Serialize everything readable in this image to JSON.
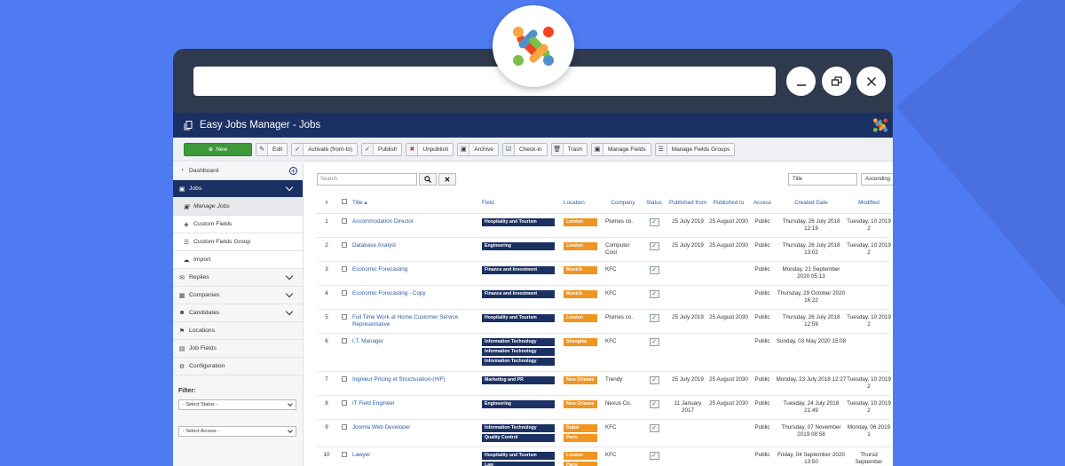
{
  "app": {
    "title": "Easy Jobs Manager - Jobs"
  },
  "toolbar": {
    "new_label": "New",
    "edit_label": "Edit",
    "activate_label": "Activate (from-to)",
    "publish_label": "Publish",
    "unpublish_label": "Unpublish",
    "archive_label": "Archive",
    "checkin_label": "Check-in",
    "trash_label": "Trash",
    "manage_fields_label": "Manage Fields",
    "manage_fields_groups_label": "Manage Fields Groups"
  },
  "sidebar": {
    "items": [
      {
        "label": "Dashboard",
        "icon": "dashboard-icon"
      },
      {
        "label": "Jobs",
        "icon": "briefcase-icon"
      },
      {
        "label": "Manage Jobs",
        "icon": "briefcase-icon"
      },
      {
        "label": "Custom Fields",
        "icon": "cube-icon"
      },
      {
        "label": "Custom Fields Group",
        "icon": "list-icon"
      },
      {
        "label": "Import",
        "icon": "cloud-upload-icon"
      },
      {
        "label": "Replies",
        "icon": "envelope-icon"
      },
      {
        "label": "Companies",
        "icon": "building-icon"
      },
      {
        "label": "Candidates",
        "icon": "users-icon"
      },
      {
        "label": "Locations",
        "icon": "map-icon"
      },
      {
        "label": "Job Fields",
        "icon": "folder-icon"
      },
      {
        "label": "Configuration",
        "icon": "gear-icon"
      }
    ],
    "filter_label": "Filter:",
    "status_select": "- Select Status -",
    "access_select": "- Select Access -"
  },
  "search": {
    "placeholder": "Search",
    "sort_field": "Title",
    "sort_dir": "Ascending"
  },
  "table": {
    "headers": {
      "num": "#",
      "title": "Title ▴",
      "field": "Field",
      "location": "Location",
      "company": "Company",
      "status": "Status",
      "published_from": "Published from",
      "published_to": "Published to",
      "access": "Access",
      "created": "Created Date",
      "modified": "Modified"
    },
    "rows": [
      {
        "num": "1",
        "title": "Accommodation Director",
        "fields": [
          "Hospitality and Tourism"
        ],
        "locations": [
          "London"
        ],
        "company": "Plumes co.",
        "from": "25 July 2019",
        "to": "25 August 2030",
        "access": "Public",
        "created": "Thursday, 26 July 2018 12:19",
        "modified": "Tuesday, 10 2019 2"
      },
      {
        "num": "2",
        "title": "Database Analyst",
        "fields": [
          "Engineering"
        ],
        "locations": [
          "London"
        ],
        "company": "Computer Cool",
        "from": "25 July 2019",
        "to": "25 August 2030",
        "access": "Public",
        "created": "Thursday, 26 July 2018 13:02",
        "modified": "Tuesday, 10 2019 2"
      },
      {
        "num": "3",
        "title": "Economic Forecasting",
        "fields": [
          "Finance and Investment"
        ],
        "locations": [
          "Munich"
        ],
        "company": "KFC",
        "from": "",
        "to": "",
        "access": "Public",
        "created": "Monday, 21 September 2020 05:13",
        "modified": ""
      },
      {
        "num": "4",
        "title": "Economic Forecasting - Copy",
        "fields": [
          "Finance and Investment"
        ],
        "locations": [
          "Munich"
        ],
        "company": "KFC",
        "from": "",
        "to": "",
        "access": "Public",
        "created": "Thursday, 29 October 2020 16:22",
        "modified": ""
      },
      {
        "num": "5",
        "title": "Full Time Work at Home Customer Service Representative",
        "fields": [
          "Hospitality and Tourism"
        ],
        "locations": [
          "London"
        ],
        "company": "Plumes co.",
        "from": "25 July 2019",
        "to": "25 August 2030",
        "access": "Public",
        "created": "Thursday, 26 July 2018 12:59",
        "modified": "Tuesday, 10 2019 2"
      },
      {
        "num": "6",
        "title": "I.T. Manager",
        "fields": [
          "Information Technology",
          "Information Technology",
          "Information Technology"
        ],
        "locations": [
          "Shanghai"
        ],
        "company": "KFC",
        "from": "",
        "to": "",
        "access": "Public",
        "created": "Sunday, 03 May 2020 15:08",
        "modified": ""
      },
      {
        "num": "7",
        "title": "Ingnieur Pricing et Structuration-(H/F)",
        "fields": [
          "Marketing and PR"
        ],
        "locations": [
          "New Orleans"
        ],
        "company": "Trendy",
        "from": "25 July 2019",
        "to": "25 August 2030",
        "access": "Public",
        "created": "Monday, 23 July 2018 12:27",
        "modified": "Tuesday, 10 2019 2"
      },
      {
        "num": "8",
        "title": "IT Field Engineer",
        "fields": [
          "Engineering"
        ],
        "locations": [
          "New Orleans"
        ],
        "company": "Nexus Co.",
        "from": "11 January 2017",
        "to": "25 August 2030",
        "access": "Public",
        "created": "Tuesday, 24 July 2018 21:49",
        "modified": "Tuesday, 10 2019 2"
      },
      {
        "num": "9",
        "title": "Joomla Web Developer",
        "fields": [
          "Information Technology",
          "Quality Control"
        ],
        "locations": [
          "Dubai",
          "Paris"
        ],
        "company": "KFC",
        "from": "",
        "to": "",
        "access": "Public",
        "created": "Thursday, 07 November 2019 08:58",
        "modified": "Monday, 06 2019 1"
      },
      {
        "num": "10",
        "title": "Lawyer",
        "fields": [
          "Hospitality and Tourism",
          "Law"
        ],
        "locations": [
          "London",
          "Paris"
        ],
        "company": "KFC",
        "from": "",
        "to": "",
        "access": "Public",
        "created": "Friday, 04 September 2020 13:50",
        "modified": "Thursd September"
      }
    ]
  },
  "colors": {
    "background": "#4f7bf2",
    "navy": "#1b3163",
    "orange": "#f0951f",
    "green": "#3d9a3b"
  }
}
